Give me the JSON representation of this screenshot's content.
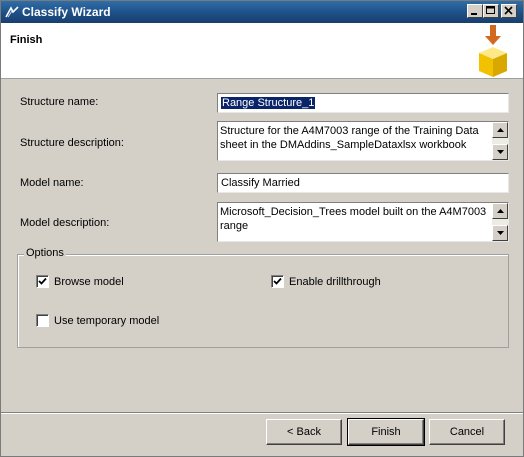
{
  "window": {
    "title": "Classify Wizard"
  },
  "header": {
    "page_title": "Finish"
  },
  "form": {
    "structure_name_label": "Structure name:",
    "structure_name_value": "Range Structure_1",
    "structure_description_label": "Structure description:",
    "structure_description_value": "Structure for the A4M7003 range of the Training Data sheet in the DMAddins_SampleDataxlsx workbook",
    "model_name_label": "Model name:",
    "model_name_value": "Classify Married",
    "model_description_label": "Model description:",
    "model_description_value": "Microsoft_Decision_Trees model built on the A4M7003 range"
  },
  "options": {
    "legend": "Options",
    "browse_model": {
      "label": "Browse model",
      "checked": true
    },
    "enable_drillthrough": {
      "label": "Enable drillthrough",
      "checked": true
    },
    "use_temporary_model": {
      "label": "Use temporary model",
      "checked": false
    }
  },
  "buttons": {
    "back": "< Back",
    "finish": "Finish",
    "cancel": "Cancel"
  },
  "icons": {
    "app": "wizard-app-icon",
    "minimize": "minimize-icon",
    "maximize": "maximize-icon",
    "close": "close-icon",
    "header": "export-cube-icon",
    "scroll_up": "scroll-up-arrow-icon",
    "scroll_down": "scroll-down-arrow-icon",
    "checkmark": "checkmark-icon"
  },
  "colors": {
    "titlebar": "#1e4f86",
    "selection": "#0a246a",
    "cube": "#f2c200",
    "arrow": "#d2691e"
  }
}
